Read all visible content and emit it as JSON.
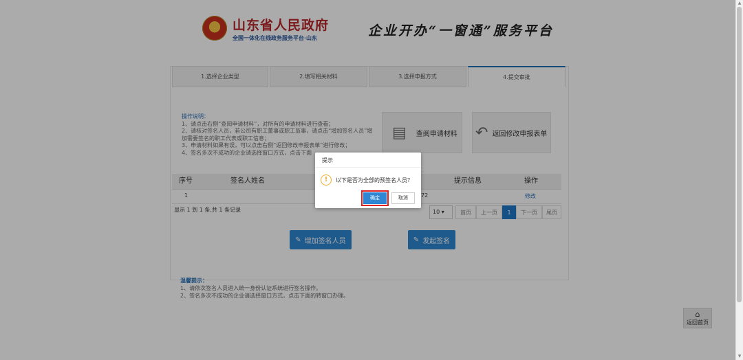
{
  "header": {
    "gov_title": "山东省人民政府",
    "gov_subtitle": "全国一体化在线政务服务平台·山东",
    "platform_title": "企业开办“一窗通”服务平台"
  },
  "steps": [
    {
      "label": "1.选择企业类型"
    },
    {
      "label": "2.填写相关材料"
    },
    {
      "label": "3.选择申报方式"
    },
    {
      "label": "4.提交审批"
    }
  ],
  "instructions": {
    "title": "操作说明：",
    "lines": [
      "1、请点击右侧“查阅申请材料”，对所有的申请材料进行查看；",
      "2、请核对签名人员，若公司有职工董事或职工监事，请点击“增加签名人员”增",
      "加需要签名的职工代表或职工信息；",
      "3、申请材料如果有误，可以点击右侧“返回修改申报表单”进行修改；",
      "4、签名多次不成功的企业请选择窗口方式，点击下面"
    ]
  },
  "actions": {
    "view_materials": "查阅申请材料",
    "back_modify": "返回修改申报表单"
  },
  "table": {
    "headers": [
      "序号",
      "签名人姓名",
      "提示信息",
      "操作"
    ],
    "rows": [
      {
        "index": "1",
        "partial": "72",
        "action": "修改"
      }
    ],
    "count_text": "显示 1 到 1 条,共 1 条记录"
  },
  "pagination": {
    "page_size": "10",
    "first": "首页",
    "prev": "上一页",
    "current": "1",
    "next": "下一页",
    "last": "尾页"
  },
  "buttons": {
    "add_signer": "增加签名人员",
    "start_sign": "发起签名"
  },
  "tips": {
    "title": "温馨提示：",
    "lines": [
      "1、请依次签名人员进入统一身份认证系统进行签名操作。",
      "2、签名多次不成功的企业请选择窗口方式，点击下面的转窗口办理。"
    ]
  },
  "side": {
    "home_label": "返回首页"
  },
  "modal": {
    "title": "提示",
    "message": "以下是否为全部的预签名人员？",
    "ok": "确定",
    "cancel": "取消"
  }
}
